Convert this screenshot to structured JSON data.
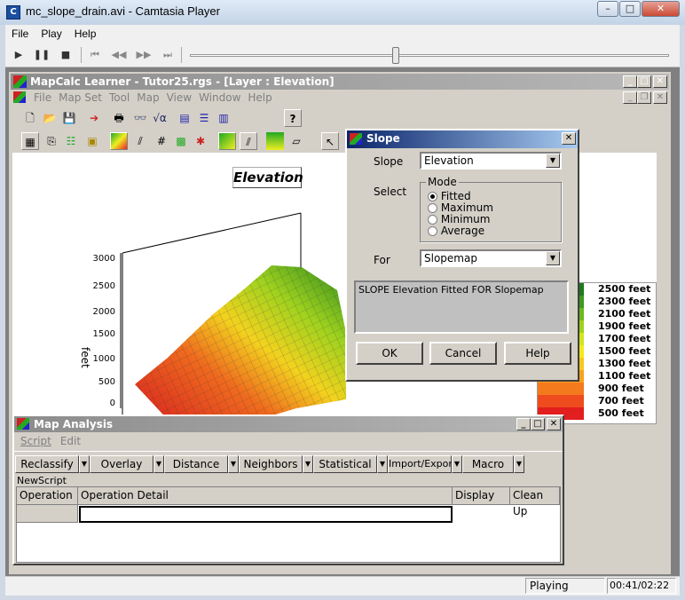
{
  "outer_window": {
    "title": "mc_slope_drain.avi - Camtasia Player",
    "menu": [
      "File",
      "Play",
      "Help"
    ],
    "controls": {
      "minimize": "–",
      "maximize": "□",
      "close": "✕"
    }
  },
  "player": {
    "buttons": [
      "play",
      "pause",
      "stop",
      "skip-start",
      "rewind",
      "fast-forward",
      "skip-end"
    ],
    "seek_position_fraction": 0.43
  },
  "status_bar": {
    "state": "Playing",
    "time": "00:41/02:22"
  },
  "mapcalc": {
    "title": "MapCalc Learner - Tutor25.rgs - [Layer : Elevation]",
    "menu": [
      "File",
      "Map Set",
      "Tool",
      "Map",
      "View",
      "Window",
      "Help"
    ],
    "map_title": "Elevation",
    "y_axis_label": "feet",
    "y_ticks": [
      "3000",
      "2500",
      "2000",
      "1500",
      "1000",
      "500",
      "0"
    ],
    "legend": [
      {
        "label": "2500 feet",
        "color": "#1e7a1e"
      },
      {
        "label": "2300 feet",
        "color": "#3d9a1e"
      },
      {
        "label": "2100 feet",
        "color": "#6cb81e"
      },
      {
        "label": "1900 feet",
        "color": "#9fd21e"
      },
      {
        "label": "1700 feet",
        "color": "#d1e61e"
      },
      {
        "label": "1500 feet",
        "color": "#f2ea1e"
      },
      {
        "label": "1300 feet",
        "color": "#f9c81e"
      },
      {
        "label": "1100 feet",
        "color": "#f8a21e"
      },
      {
        "label": "900 feet",
        "color": "#f47a1e"
      },
      {
        "label": "700 feet",
        "color": "#ee4c1e"
      },
      {
        "label": "500 feet",
        "color": "#e21e1e"
      }
    ]
  },
  "slope_dialog": {
    "title": "Slope",
    "slope_label": "Slope",
    "slope_value": "Elevation",
    "select_label": "Select",
    "mode_group": "Mode",
    "modes": [
      {
        "label": "Fitted",
        "selected": true
      },
      {
        "label": "Maximum",
        "selected": false
      },
      {
        "label": "Minimum",
        "selected": false
      },
      {
        "label": "Average",
        "selected": false
      }
    ],
    "for_label": "For",
    "for_value": "Slopemap",
    "command_preview": "SLOPE Elevation Fitted FOR Slopemap",
    "ok": "OK",
    "cancel": "Cancel",
    "help": "Help"
  },
  "map_analysis": {
    "title": "Map Analysis",
    "menu": [
      "Script",
      "Edit"
    ],
    "buttons": [
      "Reclassify",
      "Overlay",
      "Distance",
      "Neighbors",
      "Statistical",
      "Import/Export",
      "Macro"
    ],
    "script_name": "NewScript",
    "columns": [
      "Operation",
      "Operation Detail",
      "Display",
      "Clean Up"
    ]
  }
}
